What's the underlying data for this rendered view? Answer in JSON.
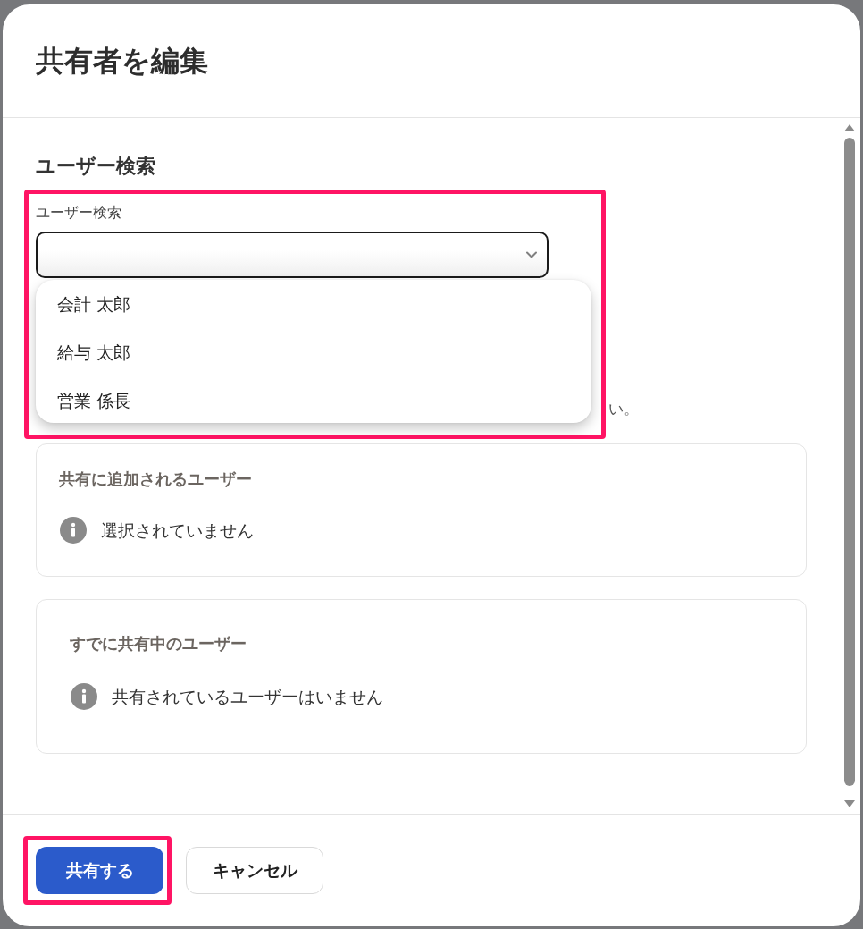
{
  "dialog": {
    "title": "共有者を編集"
  },
  "user_search": {
    "heading": "ユーザー検索",
    "highlighted": true,
    "field": {
      "label": "ユーザー検索",
      "expanded": true,
      "options": [
        {
          "label": "会計 太郎",
          "selected": false
        },
        {
          "label": "給与 太郎",
          "selected": false
        },
        {
          "label": "営業 係長",
          "selected": false
        }
      ]
    },
    "helper_text": "い。"
  },
  "cards": [
    {
      "title": "共有に追加されるユーザー",
      "message": "選択されていません"
    },
    {
      "title": "すでに共有中のユーザー",
      "message": "共有されているユーザーはいません"
    }
  ],
  "footer": {
    "buttons": [
      {
        "label": "共有する",
        "kind": "primary",
        "highlighted": true
      },
      {
        "label": "キャンセル",
        "kind": "secondary",
        "highlighted": false
      }
    ]
  }
}
